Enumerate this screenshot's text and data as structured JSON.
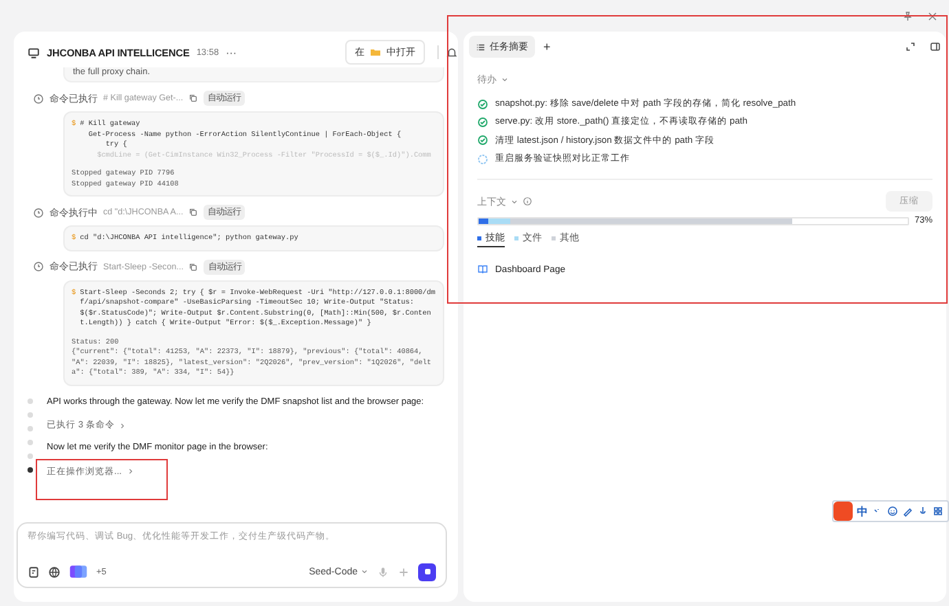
{
  "chat": {
    "title": "JHCONBA API INTELLICENCE",
    "time": "13:58",
    "more": "···",
    "open_in": {
      "prefix": "在",
      "suffix": "中打开"
    },
    "previous_text": "the full proxy chain.",
    "commands": [
      {
        "status": "命令已执行",
        "summary": "# Kill gateway Get-...",
        "badge": "自动运行",
        "prompt": "$",
        "lines": [
          {
            "text": "# Kill gateway",
            "faded": false
          },
          {
            "text": "  Get-Process -Name python -ErrorAction SilentlyContinue | ForEach-Object {",
            "faded": false
          },
          {
            "text": "      try {",
            "faded": false
          },
          {
            "text": "    $cmdLine = (Get-CimInstance Win32_Process -Filter \"ProcessId = $($_.Id)\").Comm",
            "faded": true
          }
        ],
        "output": "Stopped gateway PID 7796\nStopped gateway PID 44108"
      },
      {
        "status": "命令执行中",
        "summary": "cd \"d:\\JHCONBA A...",
        "badge": "自动运行",
        "prompt": "$",
        "lines": [
          {
            "text": "cd \"d:\\JHCONBA API intelligence\"; python gateway.py",
            "faded": false
          }
        ]
      },
      {
        "status": "命令已执行",
        "summary": "Start-Sleep -Secon...",
        "badge": "自动运行",
        "prompt": "$",
        "lines": [
          {
            "text": "Start-Sleep -Seconds 2; try { $r = Invoke-WebRequest -Uri \"http://127.0.0.1:8000/dmf/api/snapshot-compare\" -UseBasicParsing -TimeoutSec 10; Write-Output \"Status: $($r.StatusCode)\"; Write-Output $r.Content.Substring(0, [Math]::Min(500, $r.Content.Length)) } catch { Write-Output \"Error: $($_.Exception.Message)\" }",
            "faded": false
          }
        ],
        "output": "Status: 200\n{\"current\": {\"total\": 41253, \"A\": 22373, \"I\": 18879}, \"previous\": {\"total\": 40864, \"A\": 22039, \"I\": 18825}, \"latest_version\": \"2Q2026\", \"prev_version\": \"1Q2026\", \"delta\": {\"total\": 389, \"A\": 334, \"I\": 54}}"
      }
    ],
    "messages": [
      {
        "kind": "text",
        "text": "API works through the gateway. Now let me verify the DMF snapshot list and the browser page:"
      },
      {
        "kind": "step",
        "text": "已执行 3 条命令"
      },
      {
        "kind": "text",
        "text": "Now let me verify the DMF monitor page in the browser:"
      },
      {
        "kind": "step",
        "text": "正在操作浏览器..."
      }
    ],
    "timeline": [
      {
        "selected": false
      },
      {
        "selected": false
      },
      {
        "selected": false
      },
      {
        "selected": false
      },
      {
        "selected": false
      },
      {
        "selected": true
      }
    ],
    "input": {
      "placeholder": "帮你编写代码、调试 Bug、优化性能等开发工作，交付生产级代码产物。",
      "extra_count": "+5",
      "model": "Seed-Code"
    }
  },
  "summary": {
    "tabs": [
      {
        "label": "任务摘要",
        "selected": true
      }
    ],
    "add_tab": "+",
    "todo_heading": "待办",
    "todos": [
      {
        "text": "snapshot.py: 移除 save/delete 中对 path 字段的存储，简化 resolve_path",
        "done": true
      },
      {
        "text": "serve.py: 改用 store._path() 直接定位，不再读取存储的 path",
        "done": true
      },
      {
        "text": "清理 latest.json / history.json 数据文件中的 path 字段",
        "done": true
      },
      {
        "text": "重启服务验证快照对比正常工作",
        "done": false
      }
    ],
    "context": {
      "heading": "上下文",
      "compress_button": "压缩",
      "percent": "73%",
      "level": 0.73,
      "segments": [
        {
          "label": "技能",
          "color": "#2f6fe8",
          "selected": true
        },
        {
          "label": "文件",
          "color": "#a9dcf5",
          "selected": false
        },
        {
          "label": "其他",
          "color": "#cfd3da",
          "selected": false
        }
      ]
    },
    "pages": [
      "Dashboard Page"
    ]
  },
  "ime_toolbar": {
    "mode": "中"
  }
}
